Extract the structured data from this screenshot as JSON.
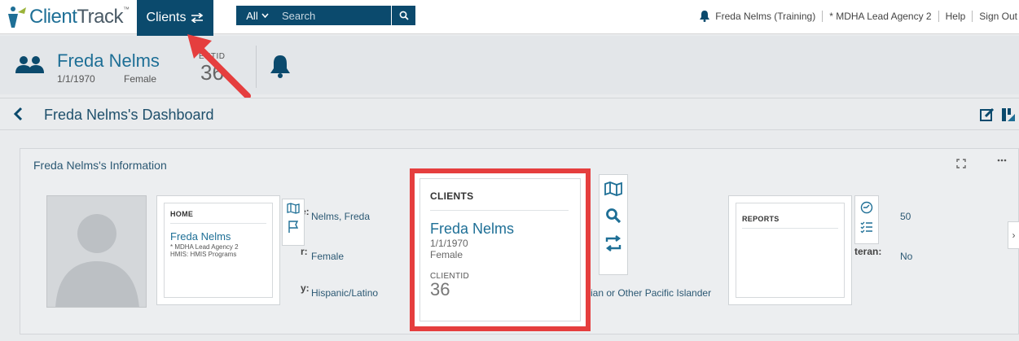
{
  "topbar": {
    "logo_prefix": "Client",
    "logo_suffix": "Track",
    "clients_label": "Clients",
    "search_scope": "All",
    "search_placeholder": "Search",
    "user": "Freda Nelms (Training)",
    "agency": "* MDHA Lead Agency 2",
    "help": "Help",
    "sign_out": "Sign Out"
  },
  "client": {
    "name": "Freda Nelms",
    "dob": "1/1/1970",
    "gender": "Female",
    "clientid_label": "ENTID",
    "clientid_value": "36"
  },
  "dashboard": {
    "title": "Freda Nelms's Dashboard"
  },
  "info": {
    "title": "Freda Nelms's Information",
    "fields": {
      "name_value": "Nelms, Freda",
      "gender_value": "Female",
      "ethnicity_value": "Hispanic/Latino",
      "race_value": "ian or Other Pacific Islander",
      "age_value": "50",
      "veteran_label": "teran:",
      "veteran_value": "No",
      "label_e": "e:",
      "label_r": "r:",
      "label_y": "y:"
    }
  },
  "home_card": {
    "header": "HOME",
    "name": "Freda Nelms",
    "agency": "* MDHA Lead Agency 2",
    "program": "HMIS: HMIS Programs"
  },
  "clients_card": {
    "header": "CLIENTS",
    "name": "Freda Nelms",
    "dob": "1/1/1970",
    "gender": "Female",
    "clientid_label": "CLIENTID",
    "clientid_value": "36"
  },
  "reports_card": {
    "header": "REPORTS"
  },
  "colors": {
    "brand_dark": "#0b4a6d",
    "link_blue": "#1e6f96",
    "highlight_red": "#e53e3e"
  }
}
